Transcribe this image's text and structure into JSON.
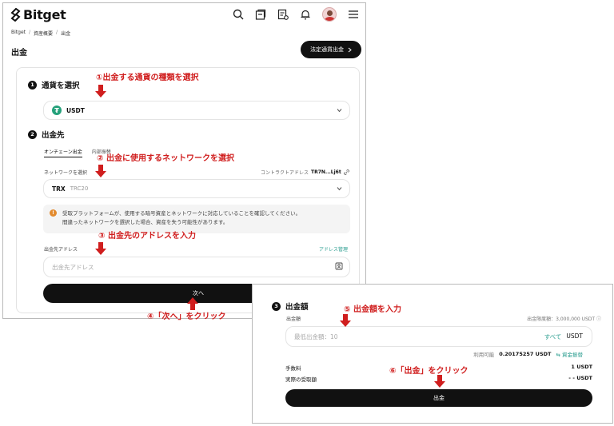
{
  "header": {
    "logo_text": "Bitget",
    "icons": [
      "search-icon",
      "wallet-icon",
      "orders-icon",
      "bell-icon",
      "avatar",
      "menu-icon"
    ]
  },
  "breadcrumb": [
    "Bitget",
    "資産概要",
    "出金"
  ],
  "page_title": "出金",
  "fiat_button": "法定通貨出金",
  "step1": {
    "num": "1",
    "title": "通貨を選択",
    "coin": "USDT"
  },
  "step2": {
    "num": "2",
    "title": "出金先",
    "tabs": [
      "オンチェーン出金",
      "内部振替"
    ],
    "network_label": "ネットワークを選択",
    "contract_label": "コントラクトアドレス",
    "contract_value": "TR7N...Lj6t",
    "network": "TRX",
    "network_sub": "TRC20",
    "warning_line1": "受取プラットフォームが、使用する暗号資産とネットワークに対応していることを確認してください。",
    "warning_line2": "間違ったネットワークを選択した場合、資産を失う可能性があります。",
    "address_label": "出金先アドレス",
    "address_manage": "アドレス管理",
    "address_placeholder": "出金先アドレス",
    "next_button": "次へ"
  },
  "step3": {
    "num": "3",
    "title": "出金額",
    "amount_label": "出金額",
    "limit_label": "出金限度額：",
    "limit_value": "3,000,000 USDT",
    "amount_placeholder": "最低出金額：10",
    "all_label": "すべて",
    "unit": "USDT",
    "available_label": "利用可能",
    "available_value": "0.20175257 USDT",
    "transfer_label": "資金振替",
    "fee_label": "手数料",
    "fee_value": "1 USDT",
    "receive_label": "実際の受取額",
    "receive_value": "- - USDT",
    "withdraw_button": "出金"
  },
  "annotations": {
    "a1": "①出金する通貨の種類を選択",
    "a2": "② 出金に使用するネットワークを選択",
    "a3": "③ 出金先のアドレスを入力",
    "a4": "④「次へ」をクリック",
    "a5": "⑤ 出金額を入力",
    "a6": "⑥「出金」をクリック"
  },
  "colors": {
    "accent": "#2a9d8f",
    "annotation": "#d01e1e",
    "button": "#111111",
    "usdt": "#26a17b"
  }
}
